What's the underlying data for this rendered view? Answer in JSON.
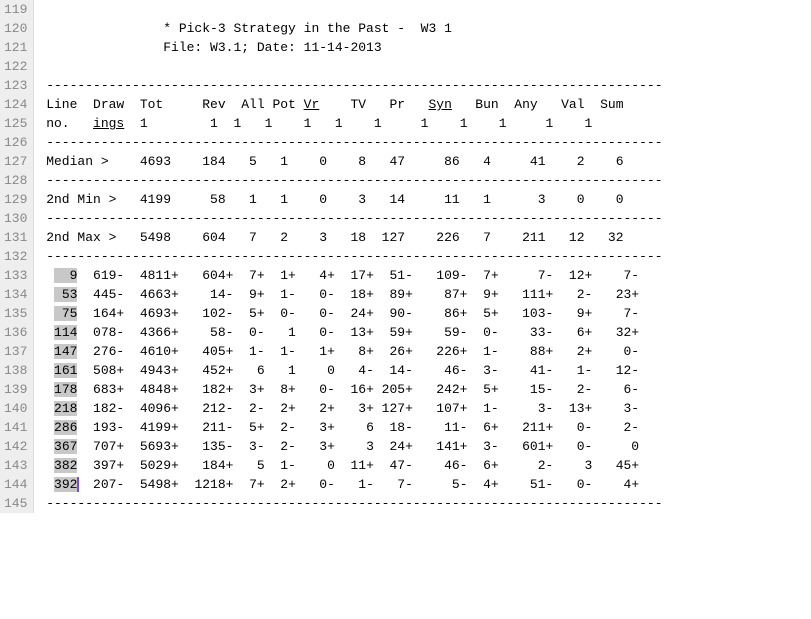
{
  "lineStart": 119,
  "lineEnd": 145,
  "title": "* Pick-3 Strategy in the Past -  W3 1",
  "fileLine": "File: W3.1; Date: 11-14-2013",
  "sep": "-------------------------------------------------------------------------------",
  "hdr1": {
    "c0": "Line",
    "c1": "Draw",
    "c2": "Tot",
    "c3": "Rev",
    "c4": "All",
    "c5": "Pot",
    "c6": "Vr",
    "c7": "TV",
    "c8": "Pr",
    "c9": "Syn",
    "c10": "Bun",
    "c11": "Any",
    "c12": "Val",
    "c13": "Sum"
  },
  "hdr2": {
    "c0": "no.",
    "c1": "ings",
    "c2": "1",
    "c3": "1",
    "c4": "1",
    "c5": "1",
    "c6": "1",
    "c7": "1",
    "c8": "1",
    "c9": "1",
    "c10": "1",
    "c11": "1",
    "c12": "1",
    "c13": "1"
  },
  "stats": [
    {
      "label": "Median >",
      "v": [
        "4693",
        "184",
        "5",
        "1",
        "0",
        "8",
        "47",
        "86",
        "4",
        "41",
        "2",
        "6"
      ]
    },
    {
      "label": "2nd Min >",
      "v": [
        "4199",
        "58",
        "1",
        "1",
        "0",
        "3",
        "14",
        "11",
        "1",
        "3",
        "0",
        "0"
      ]
    },
    {
      "label": "2nd Max >",
      "v": [
        "5498",
        "604",
        "7",
        "2",
        "3",
        "18",
        "127",
        "226",
        "7",
        "211",
        "12",
        "32"
      ]
    }
  ],
  "rows": [
    {
      "no": "9",
      "draw": "619-",
      "tot": "4811+",
      "rev": "604+",
      "all": "7+",
      "pot": "1+",
      "vr": "4+",
      "tv": "17+",
      "pr": "51-",
      "syn": "109-",
      "bun": "7+",
      "any": "7-",
      "val": "12+",
      "sum": "7-"
    },
    {
      "no": "53",
      "draw": "445-",
      "tot": "4663+",
      "rev": "14-",
      "all": "9+",
      "pot": "1-",
      "vr": "0-",
      "tv": "18+",
      "pr": "89+",
      "syn": "87+",
      "bun": "9+",
      "any": "111+",
      "val": "2-",
      "sum": "23+"
    },
    {
      "no": "75",
      "draw": "164+",
      "tot": "4693+",
      "rev": "102-",
      "all": "5+",
      "pot": "0-",
      "vr": "0-",
      "tv": "24+",
      "pr": "90-",
      "syn": "86+",
      "bun": "5+",
      "any": "103-",
      "val": "9+",
      "sum": "7-"
    },
    {
      "no": "114",
      "draw": "078-",
      "tot": "4366+",
      "rev": "58-",
      "all": "0-",
      "pot": "1",
      "vr": "0-",
      "tv": "13+",
      "pr": "59+",
      "syn": "59-",
      "bun": "0-",
      "any": "33-",
      "val": "6+",
      "sum": "32+"
    },
    {
      "no": "147",
      "draw": "276-",
      "tot": "4610+",
      "rev": "405+",
      "all": "1-",
      "pot": "1-",
      "vr": "1+",
      "tv": "8+",
      "pr": "26+",
      "syn": "226+",
      "bun": "1-",
      "any": "88+",
      "val": "2+",
      "sum": "0-"
    },
    {
      "no": "161",
      "draw": "508+",
      "tot": "4943+",
      "rev": "452+",
      "all": "6",
      "pot": "1",
      "vr": "0",
      "tv": "4-",
      "pr": "14-",
      "syn": "46-",
      "bun": "3-",
      "any": "41-",
      "val": "1-",
      "sum": "12-"
    },
    {
      "no": "178",
      "draw": "683+",
      "tot": "4848+",
      "rev": "182+",
      "all": "3+",
      "pot": "8+",
      "vr": "0-",
      "tv": "16+",
      "pr": "205+",
      "syn": "242+",
      "bun": "5+",
      "any": "15-",
      "val": "2-",
      "sum": "6-"
    },
    {
      "no": "218",
      "draw": "182-",
      "tot": "4096+",
      "rev": "212-",
      "all": "2-",
      "pot": "2+",
      "vr": "2+",
      "tv": "3+",
      "pr": "127+",
      "syn": "107+",
      "bun": "1-",
      "any": "3-",
      "val": "13+",
      "sum": "3-"
    },
    {
      "no": "286",
      "draw": "193-",
      "tot": "4199+",
      "rev": "211-",
      "all": "5+",
      "pot": "2-",
      "vr": "3+",
      "tv": "6",
      "pr": "18-",
      "syn": "11-",
      "bun": "6+",
      "any": "211+",
      "val": "0-",
      "sum": "2-"
    },
    {
      "no": "367",
      "draw": "707+",
      "tot": "5693+",
      "rev": "135-",
      "all": "3-",
      "pot": "2-",
      "vr": "3+",
      "tv": "3",
      "pr": "24+",
      "syn": "141+",
      "bun": "3-",
      "any": "601+",
      "val": "0-",
      "sum": "0"
    },
    {
      "no": "382",
      "draw": "397+",
      "tot": "5029+",
      "rev": "184+",
      "all": "5",
      "pot": "1-",
      "vr": "0",
      "tv": "11+",
      "pr": "47-",
      "syn": "46-",
      "bun": "6+",
      "any": "2-",
      "val": "3",
      "sum": "45+"
    },
    {
      "no": "392",
      "draw": "207-",
      "tot": "5498+",
      "rev": "1218+",
      "all": "7+",
      "pot": "2+",
      "vr": "0-",
      "tv": "1-",
      "pr": "7-",
      "syn": "5-",
      "bun": "4+",
      "any": "51-",
      "val": "0-",
      "sum": "4+"
    }
  ]
}
